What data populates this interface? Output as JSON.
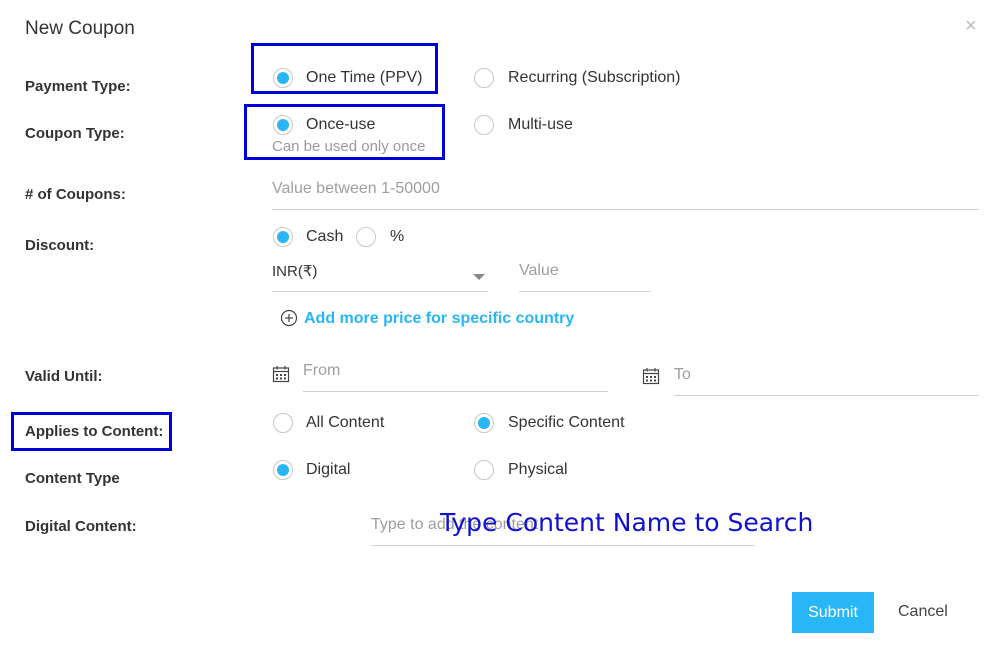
{
  "dialog": {
    "title": "New Coupon",
    "close_glyph": "×"
  },
  "payment_type": {
    "label": "Payment Type:",
    "options": [
      {
        "label": "One Time (PPV)",
        "selected": true
      },
      {
        "label": "Recurring (Subscription)",
        "selected": false
      }
    ]
  },
  "coupon_type": {
    "label": "Coupon Type:",
    "options": [
      {
        "label": "Once-use",
        "selected": true
      },
      {
        "label": "Multi-use",
        "selected": false
      }
    ],
    "hint": "Can be used only once"
  },
  "num_coupons": {
    "label": "# of Coupons:",
    "placeholder": "Value between 1-50000"
  },
  "discount": {
    "label": "Discount:",
    "options": [
      {
        "label": "Cash",
        "selected": true
      },
      {
        "label": "%",
        "selected": false
      }
    ],
    "currency": "INR(₹)",
    "value_placeholder": "Value",
    "add_more_link": "Add more price for specific country"
  },
  "valid_until": {
    "label": "Valid Until:",
    "from_placeholder": "From",
    "to_placeholder": "To"
  },
  "applies_to": {
    "label": "Applies to Content:",
    "options": [
      {
        "label": "All Content",
        "selected": false
      },
      {
        "label": "Specific Content",
        "selected": true
      }
    ]
  },
  "content_type": {
    "label": "Content Type",
    "options": [
      {
        "label": "Digital",
        "selected": true
      },
      {
        "label": "Physical",
        "selected": false
      }
    ]
  },
  "digital_content": {
    "label": "Digital Content:",
    "placeholder": "Type to add the content"
  },
  "annotation": "Type Content Name to Search",
  "buttons": {
    "submit": "Submit",
    "cancel": "Cancel"
  },
  "colors": {
    "accent": "#29b6f6",
    "highlight": "#0000d8",
    "annotation": "#1010d0"
  },
  "icons": [
    "close-icon",
    "calendar-icon",
    "plus-circle-icon",
    "chevron-down-icon"
  ]
}
